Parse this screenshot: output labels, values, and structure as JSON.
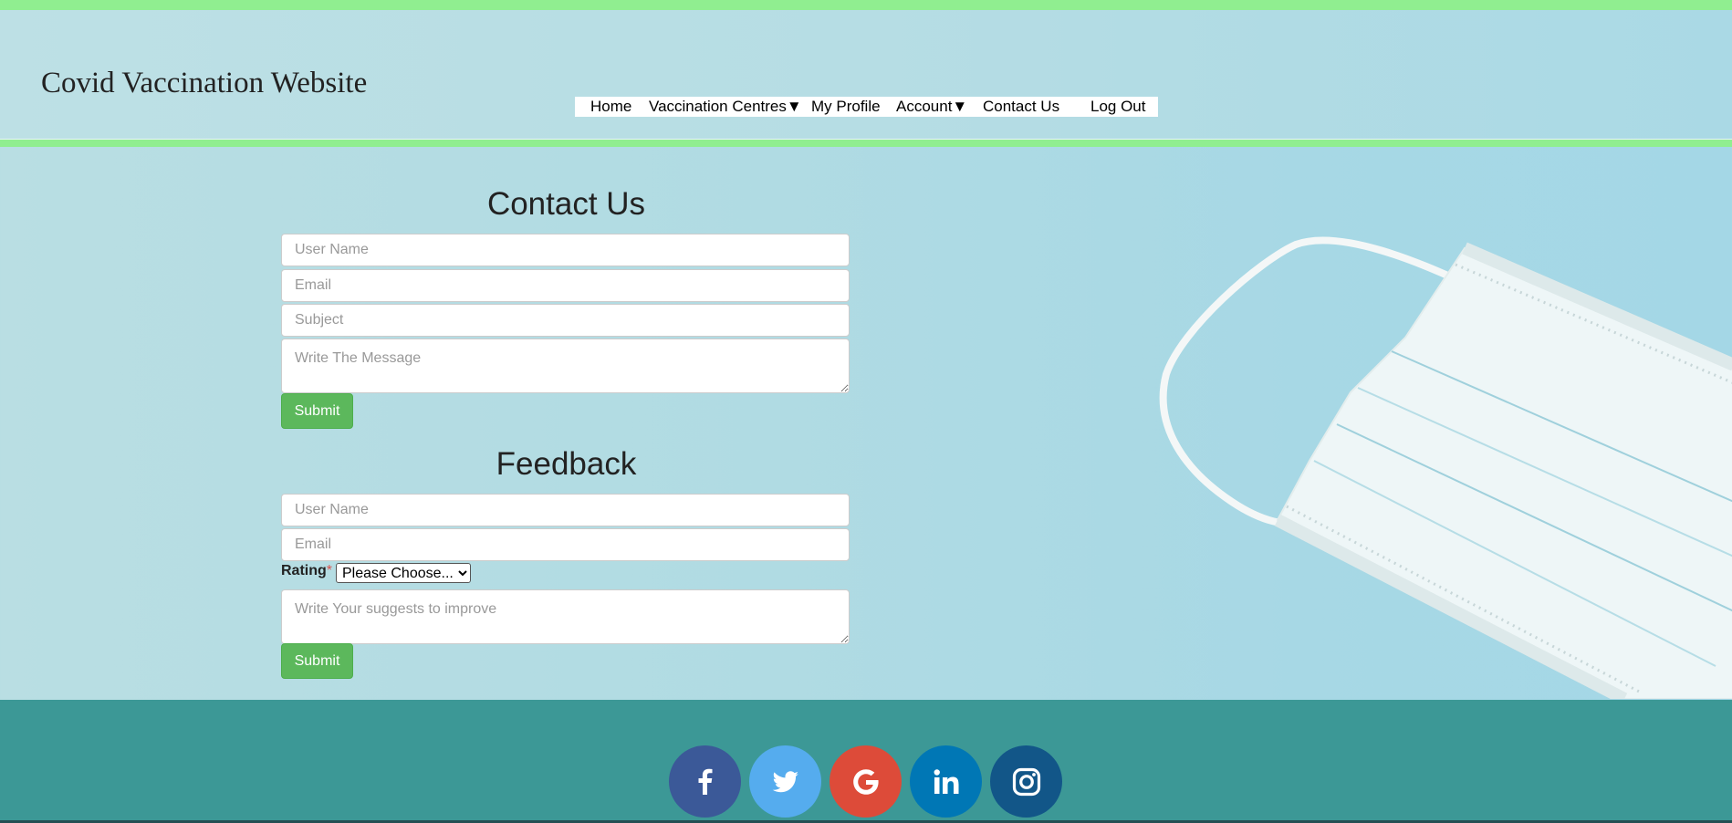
{
  "site": {
    "title": "Covid Vaccination Website"
  },
  "nav": {
    "items": [
      {
        "label": "Home"
      },
      {
        "label": "Vaccination Centres▼"
      },
      {
        "label": "My Profile"
      },
      {
        "label": "Account▼"
      },
      {
        "label": "Contact Us"
      },
      {
        "label": "Log Out"
      }
    ]
  },
  "contact": {
    "title": "Contact Us",
    "username_placeholder": "User Name",
    "email_placeholder": "Email",
    "subject_placeholder": "Subject",
    "message_placeholder": "Write The Message",
    "submit_label": "Submit"
  },
  "feedback": {
    "title": "Feedback",
    "username_placeholder": "User Name",
    "email_placeholder": "Email",
    "rating_label": "Rating",
    "rating_required": "*",
    "rating_selected": "Please Choose...",
    "suggest_placeholder": "Write Your suggests to improve",
    "submit_label": "Submit"
  },
  "footer": {
    "socials": [
      {
        "name": "facebook",
        "icon": "facebook-icon",
        "color": "#3b5998"
      },
      {
        "name": "twitter",
        "icon": "twitter-icon",
        "color": "#55acee"
      },
      {
        "name": "google",
        "icon": "google-icon",
        "color": "#dd4b39"
      },
      {
        "name": "linkedin",
        "icon": "linkedin-icon",
        "color": "#0077b5"
      },
      {
        "name": "instagram",
        "icon": "instagram-icon",
        "color": "#125688"
      }
    ]
  },
  "colors": {
    "accent_line": "#90ee90",
    "button": "#5cb85c",
    "footer": "#3c9896"
  }
}
